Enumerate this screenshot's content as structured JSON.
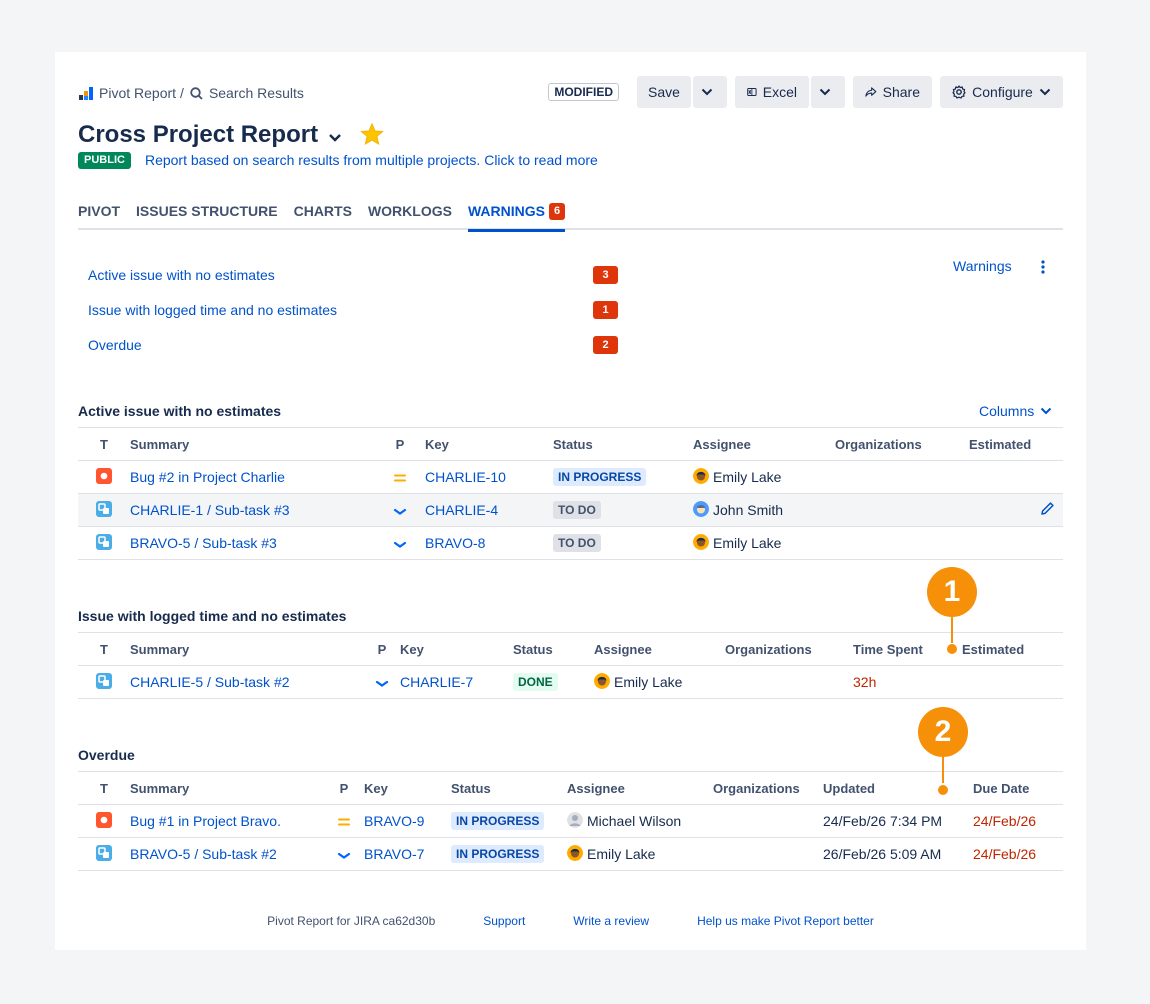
{
  "breadcrumbs": {
    "root": "Pivot Report",
    "separator": "/",
    "current": "Search Results"
  },
  "toolbar": {
    "modified": "MODIFIED",
    "save": "Save",
    "excel": "Excel",
    "share": "Share",
    "configure": "Configure"
  },
  "report": {
    "title": "Cross Project Report",
    "visibility": "PUBLIC",
    "description": "Report based on search results from multiple projects. Click to read more"
  },
  "tabs": [
    {
      "label": "PIVOT"
    },
    {
      "label": "ISSUES STRUCTURE"
    },
    {
      "label": "CHARTS"
    },
    {
      "label": "WORKLOGS"
    },
    {
      "label": "WARNINGS",
      "count": "6",
      "active": true
    }
  ],
  "warnings_summary": {
    "menu_label": "Warnings",
    "items": [
      {
        "label": "Active issue with no estimates",
        "count": "3"
      },
      {
        "label": "Issue with logged time and no estimates",
        "count": "1"
      },
      {
        "label": "Overdue",
        "count": "2"
      }
    ]
  },
  "sections": {
    "no_estimates": {
      "title": "Active issue with no estimates",
      "columns_button": "Columns",
      "headers": [
        "T",
        "Summary",
        "P",
        "Key",
        "Status",
        "Assignee",
        "Organizations",
        "Estimated"
      ],
      "rows": [
        {
          "type": "bug",
          "summary": "Bug #2 in Project Charlie",
          "priority": "medium",
          "key": "CHARLIE-10",
          "status": "IN PROGRESS",
          "assignee": "Emily Lake",
          "organizations": "",
          "estimated": ""
        },
        {
          "type": "subtask",
          "summary": "CHARLIE-1 /  Sub-task #3",
          "priority": "low",
          "key": "CHARLIE-4",
          "status": "TO DO",
          "assignee": "John Smith",
          "organizations": "",
          "estimated": ""
        },
        {
          "type": "subtask",
          "summary": "BRAVO-5 /  Sub-task #3",
          "priority": "low",
          "key": "BRAVO-8",
          "status": "TO DO",
          "assignee": "Emily Lake",
          "organizations": "",
          "estimated": ""
        }
      ]
    },
    "logged_no_estimates": {
      "title": "Issue with logged time and no estimates",
      "headers": [
        "T",
        "Summary",
        "P",
        "Key",
        "Status",
        "Assignee",
        "Organizations",
        "Time Spent",
        "Estimated"
      ],
      "rows": [
        {
          "type": "subtask",
          "summary": "CHARLIE-5 /  Sub-task #2",
          "priority": "low",
          "key": "CHARLIE-7",
          "status": "DONE",
          "assignee": "Emily Lake",
          "organizations": "",
          "time_spent": "32h",
          "estimated": ""
        }
      ]
    },
    "overdue": {
      "title": "Overdue",
      "headers": [
        "T",
        "Summary",
        "P",
        "Key",
        "Status",
        "Assignee",
        "Organizations",
        "Updated",
        "Due Date"
      ],
      "rows": [
        {
          "type": "bug",
          "summary": "Bug #1 in Project Bravo.",
          "priority": "medium",
          "key": "BRAVO-9",
          "status": "IN PROGRESS",
          "assignee": "Michael Wilson",
          "organizations": "",
          "updated": "24/Feb/26 7:34 PM",
          "due_date": "24/Feb/26"
        },
        {
          "type": "subtask",
          "summary": "BRAVO-5 /  Sub-task #2",
          "priority": "low",
          "key": "BRAVO-7",
          "status": "IN PROGRESS",
          "assignee": "Emily Lake",
          "organizations": "",
          "updated": "26/Feb/26 5:09 AM",
          "due_date": "24/Feb/26"
        }
      ]
    }
  },
  "markers": [
    "1",
    "2"
  ],
  "footer": {
    "version": "Pivot Report for JIRA ca62d30b",
    "support": "Support",
    "review": "Write a review",
    "feedback": "Help us make Pivot Report better"
  },
  "colors": {
    "link": "#0052cc",
    "badge_red": "#de350b",
    "public_green": "#00875a",
    "marker_orange": "#f79009",
    "overdue_red": "#bf2600"
  },
  "icons": {
    "bug": "bug-icon",
    "subtask": "subtask-icon",
    "priority_medium": "priority-medium-icon",
    "priority_low": "priority-low-icon"
  }
}
